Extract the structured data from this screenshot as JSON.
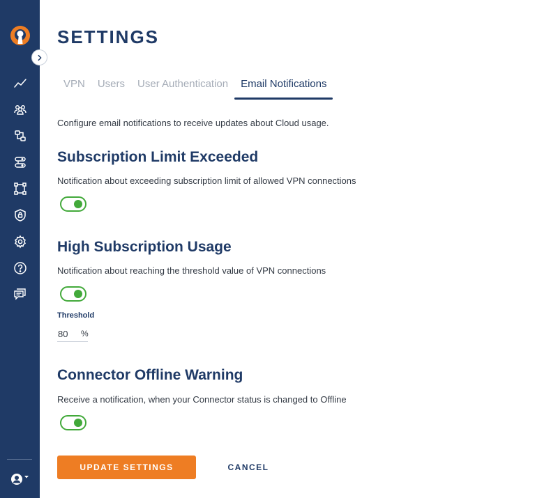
{
  "page": {
    "title": "SETTINGS"
  },
  "tabs": [
    {
      "label": "VPN"
    },
    {
      "label": "Users"
    },
    {
      "label": "User Authentication"
    },
    {
      "label": "Email Notifications",
      "active": true
    }
  ],
  "intro": "Configure email notifications to receive updates about Cloud usage.",
  "sections": [
    {
      "title": "Subscription Limit Exceeded",
      "description": "Notification about exceeding subscription limit of allowed VPN connections",
      "enabled": true
    },
    {
      "title": "High Subscription Usage",
      "description": "Notification about reaching the threshold value of VPN connections",
      "enabled": true
    },
    {
      "title": "Connector Offline Warning",
      "description": "Receive a notification, when your Connector status is changed to Offline",
      "enabled": true
    }
  ],
  "threshold": {
    "label": "Threshold",
    "value": "80",
    "unit": "%"
  },
  "actions": {
    "update_label": "UPDATE SETTINGS",
    "cancel_label": "CANCEL"
  },
  "sidebar": {
    "icons": [
      "activity-chart-icon",
      "users-group-icon",
      "network-icon",
      "servers-icon",
      "topology-icon",
      "shield-icon",
      "gear-icon",
      "help-icon",
      "chat-icon"
    ]
  },
  "colors": {
    "sidebar": "#1f3a66",
    "accent": "#ee7d23",
    "toggle_on": "#42a93a",
    "heading": "#1f3a66"
  }
}
